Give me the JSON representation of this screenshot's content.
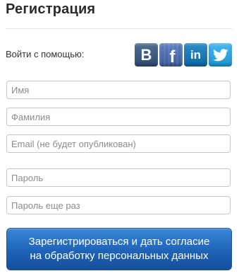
{
  "header": {
    "title": "Регистрация"
  },
  "social": {
    "label": "Войти с помощью:",
    "providers": [
      {
        "name": "vkontakte",
        "glyph": "B",
        "color": "#3b5a82"
      },
      {
        "name": "facebook",
        "glyph": "f",
        "color": "#3b5998"
      },
      {
        "name": "linkedin",
        "glyph": "in",
        "color": "#0e76a8"
      },
      {
        "name": "twitter",
        "color": "#2aa9e0"
      }
    ]
  },
  "form": {
    "name_placeholder": "Имя",
    "surname_placeholder": "Фамилия",
    "email_placeholder": "Email (не будет опубликован)",
    "password_placeholder": "Пароль",
    "password_repeat_placeholder": "Пароль еще раз",
    "submit_line1": "Зарегистрироваться и дать согласие",
    "submit_line2": "на обработку персональных данных",
    "submit_color": "#1e63b8"
  }
}
